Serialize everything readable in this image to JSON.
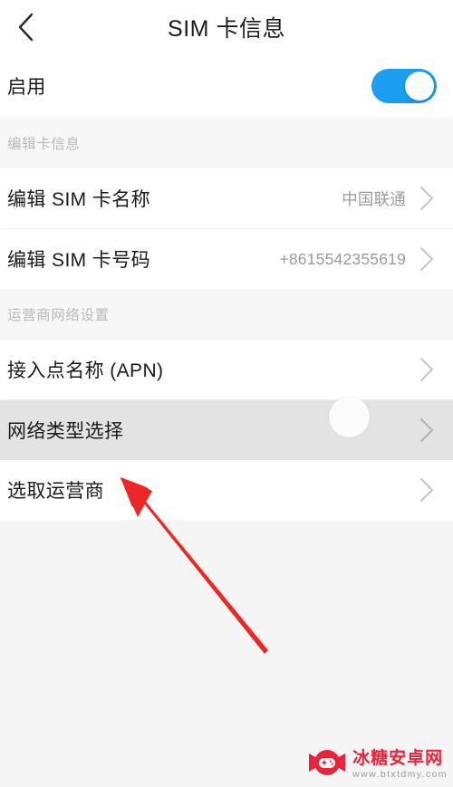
{
  "header": {
    "title": "SIM 卡信息",
    "back_icon": "chevron-left-icon"
  },
  "enable_row": {
    "label": "启用",
    "toggle_state": "on",
    "toggle_color": "#1b9df0"
  },
  "sections": [
    {
      "heading": "编辑卡信息",
      "rows": [
        {
          "label": "编辑 SIM 卡名称",
          "value": "中国联通",
          "chevron": "chevron-right-icon"
        },
        {
          "label": "编辑 SIM 卡号码",
          "value": "+8615542355619",
          "chevron": "chevron-right-icon"
        }
      ]
    },
    {
      "heading": "运营商网络设置",
      "rows": [
        {
          "label": "接入点名称 (APN)",
          "value": "",
          "chevron": "chevron-right-icon"
        },
        {
          "label": "网络类型选择",
          "value": "",
          "chevron": "chevron-right-icon",
          "pressed": true,
          "ripple": true
        },
        {
          "label": "选取运营商",
          "value": "",
          "chevron": "chevron-right-icon"
        }
      ]
    }
  ],
  "annotation": {
    "type": "arrow",
    "color": "#ef2626",
    "points_to": "网络类型选择"
  },
  "watermark": {
    "name": "冰糖安卓网",
    "url": "www.btxtdmy.com",
    "logo_icon": "candy-gamepad-logo-icon",
    "color": "#e8243c"
  }
}
